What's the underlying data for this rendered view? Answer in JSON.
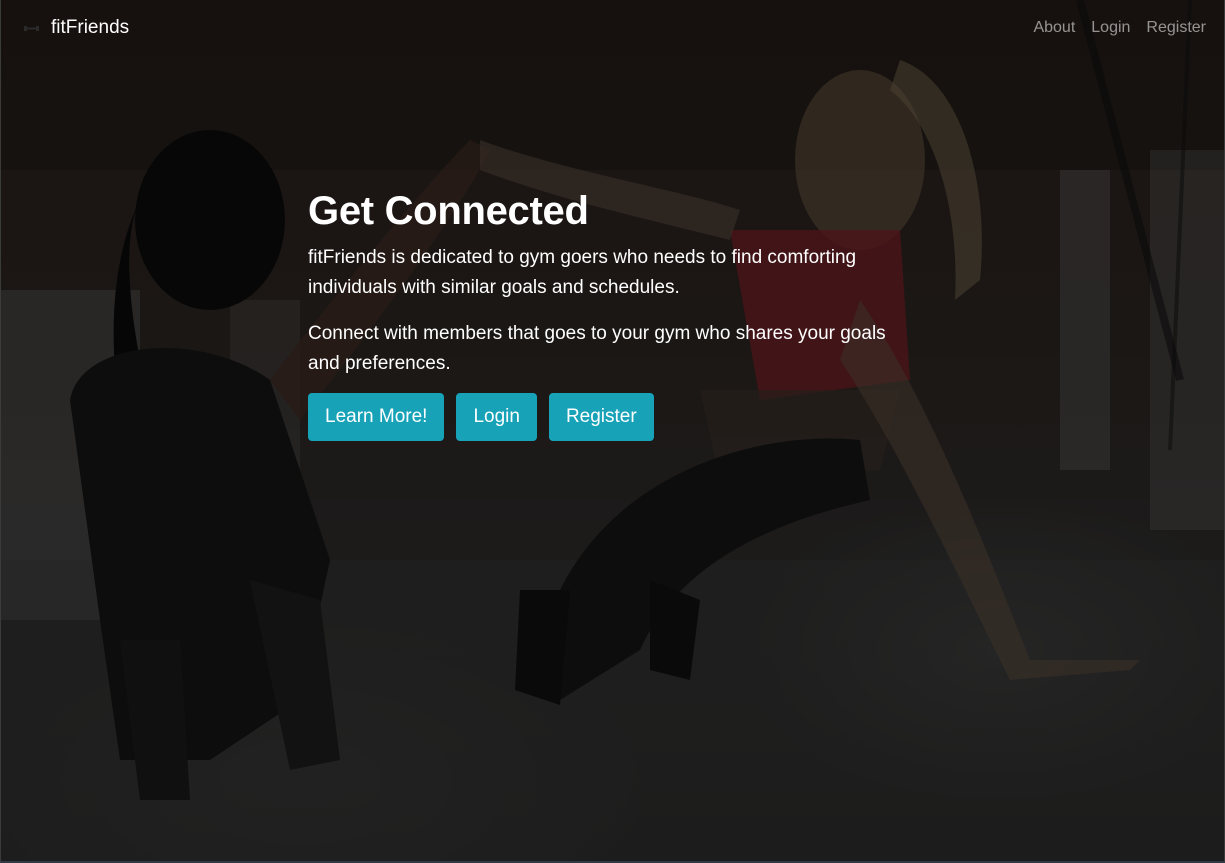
{
  "navbar": {
    "brand_icon": "dumbbell-icon",
    "brand_name": "fitFriends",
    "links": [
      {
        "label": "About"
      },
      {
        "label": "Login"
      },
      {
        "label": "Register"
      }
    ]
  },
  "hero": {
    "title": "Get Connected",
    "paragraphs": [
      "fitFriends is dedicated to gym goers who needs to find comforting individuals with similar goals and schedules.",
      "Connect with members that goes to your gym who shares your goals and preferences."
    ],
    "buttons": [
      {
        "label": "Learn More!"
      },
      {
        "label": "Login"
      },
      {
        "label": "Register"
      }
    ]
  },
  "colors": {
    "accent": "#17a2b8",
    "nav_text": "#8c8c8c",
    "background_overlay": "#1c1c1c"
  }
}
